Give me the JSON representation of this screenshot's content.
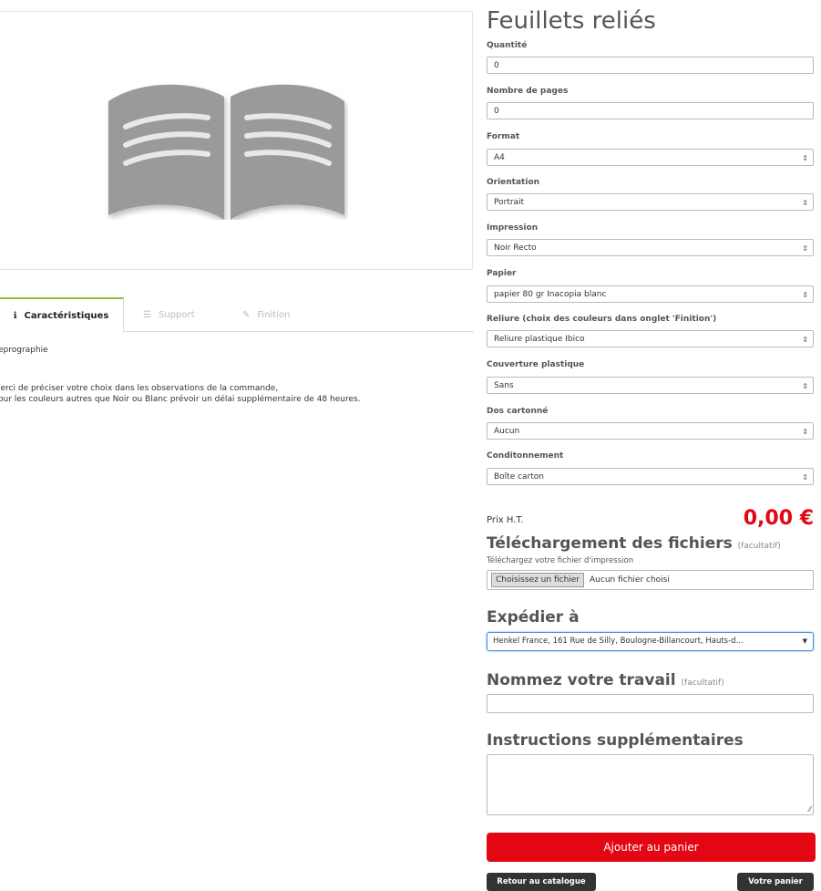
{
  "product": {
    "title": "Feuillets reliés"
  },
  "fields": [
    {
      "label": "Quantité",
      "value": "0",
      "type": "input"
    },
    {
      "label": "Nombre de pages",
      "value": "0",
      "type": "input"
    },
    {
      "label": "Format",
      "value": "A4",
      "type": "select"
    },
    {
      "label": "Orientation",
      "value": "Portrait",
      "type": "select"
    },
    {
      "label": "Impression",
      "value": "Noir Recto",
      "type": "select"
    },
    {
      "label": "Papier",
      "value": "papier 80 gr Inacopia blanc",
      "type": "select"
    },
    {
      "label": "Reliure (choix des couleurs dans onglet 'Finition')",
      "value": "Reliure plastique Ibico",
      "type": "select"
    },
    {
      "label": "Couverture plastique",
      "value": "Sans",
      "type": "select"
    },
    {
      "label": "Dos cartonné",
      "value": "Aucun",
      "type": "select"
    },
    {
      "label": "Conditonnement",
      "value": "Boîte carton",
      "type": "select"
    }
  ],
  "price": {
    "label": "Prix H.T.",
    "value": "0,00 €"
  },
  "upload": {
    "heading": "Téléchargement des fichiers",
    "optional": "(facultatif)",
    "sublabel": "Téléchargez votre fichier d'impression",
    "button": "Choisissez un fichier",
    "status": "Aucun fichier choisi"
  },
  "shipping": {
    "heading": "Expédier à",
    "selected": "Henkel France, 161 Rue de Silly, Boulogne-Billancourt, Hauts-d..."
  },
  "job_name": {
    "heading": "Nommez votre travail",
    "optional": "(facultatif)",
    "value": ""
  },
  "instructions": {
    "heading": "Instructions supplémentaires",
    "value": ""
  },
  "buttons": {
    "add_to_cart": "Ajouter au panier",
    "back_to_catalog": "Retour au catalogue",
    "your_cart": "Votre panier"
  },
  "tabs": [
    {
      "label": "Caractéristiques",
      "icon": "info-icon",
      "active": true
    },
    {
      "label": "Support",
      "icon": "list-icon",
      "active": false
    },
    {
      "label": "Finition",
      "icon": "pencil-icon",
      "active": false
    }
  ],
  "description": {
    "category": "eprographie",
    "line1": "lerci de préciser votre choix dans les observations de la commande,",
    "line2": "our les couleurs autres que Noir ou Blanc prévoir un délai supplémentaire de 48 heures."
  },
  "colors": {
    "accent_red": "#e30613",
    "tab_green": "#8fc13f",
    "book_gray": "#999999"
  }
}
